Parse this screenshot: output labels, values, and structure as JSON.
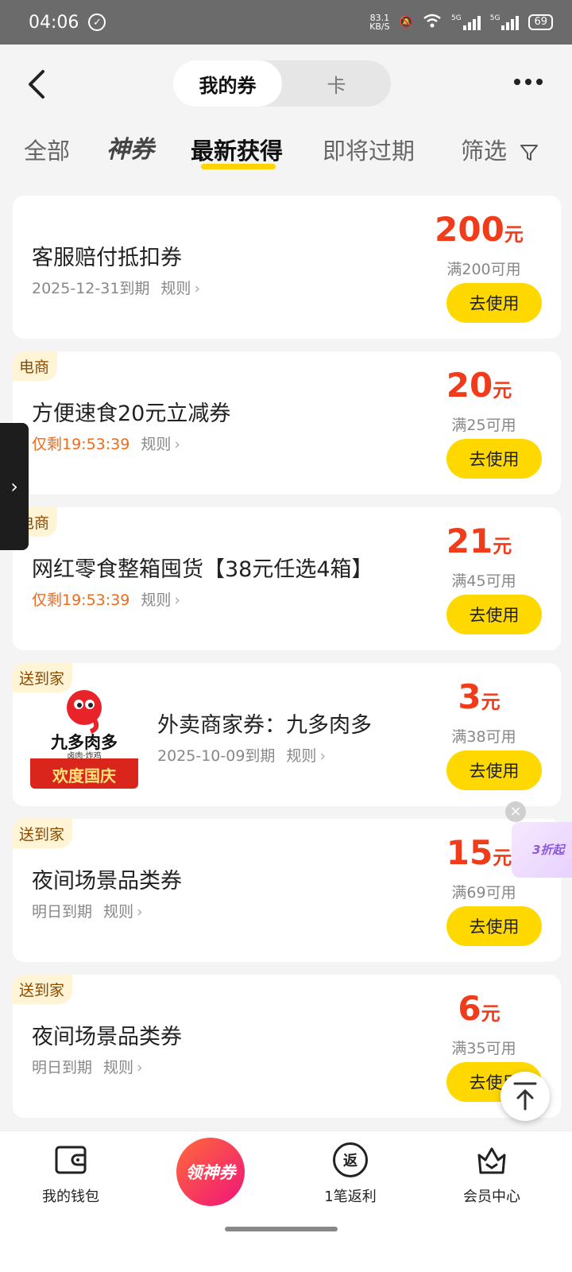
{
  "status": {
    "time": "04:06",
    "net_speed_top": "83.1",
    "net_speed_bottom": "KB/S",
    "sig1": "5G",
    "sig2": "5G",
    "battery": "69"
  },
  "header": {
    "segments": [
      "我的券",
      "卡"
    ]
  },
  "tabs": {
    "all": "全部",
    "shen": "神券",
    "latest": "最新获得",
    "expiring": "即将过期",
    "filter": "筛选"
  },
  "rules_label": "规则",
  "use_label": "去使用",
  "coupons": [
    {
      "tag": "",
      "title": "客服赔付抵扣券",
      "sub": "2025-12-31到期",
      "countdown": "",
      "amount": "200",
      "unit": "元",
      "condition": "满200可用"
    },
    {
      "tag": "电商",
      "title": "方便速食20元立减券",
      "sub": "",
      "countdown": "仅剩19:53:39",
      "amount": "20",
      "unit": "元",
      "condition": "满25可用"
    },
    {
      "tag": "电商",
      "title": "网红零食整箱囤货【38元任选4箱】",
      "sub": "",
      "countdown": "仅剩19:53:39",
      "amount": "21",
      "unit": "元",
      "condition": "满45可用"
    },
    {
      "tag": "送到家",
      "title": "外卖商家券：九多肉多",
      "sub": "2025-10-09到期",
      "countdown": "",
      "amount": "3",
      "unit": "元",
      "condition": "满38可用",
      "logo": {
        "brand": "九多肉多",
        "tagline": "卤肉·炸鸡",
        "banner": "欢度国庆"
      }
    },
    {
      "tag": "送到家",
      "title": "夜间场景品类券",
      "sub": "明日到期",
      "countdown": "",
      "amount": "15",
      "unit": "元",
      "condition": "满69可用"
    },
    {
      "tag": "送到家",
      "title": "夜间场景品类券",
      "sub": "明日到期",
      "countdown": "",
      "amount": "6",
      "unit": "元",
      "condition": "满35可用"
    }
  ],
  "float_ad_text": "3折起",
  "bottom_nav": {
    "wallet": "我的钱包",
    "center": "领神券",
    "rebate": "1笔返利",
    "member": "会员中心",
    "rebate_icon_char": "返"
  },
  "colors": {
    "accent": "#ffd800",
    "price": "#f03c1a",
    "countdown": "#f06a1a"
  }
}
